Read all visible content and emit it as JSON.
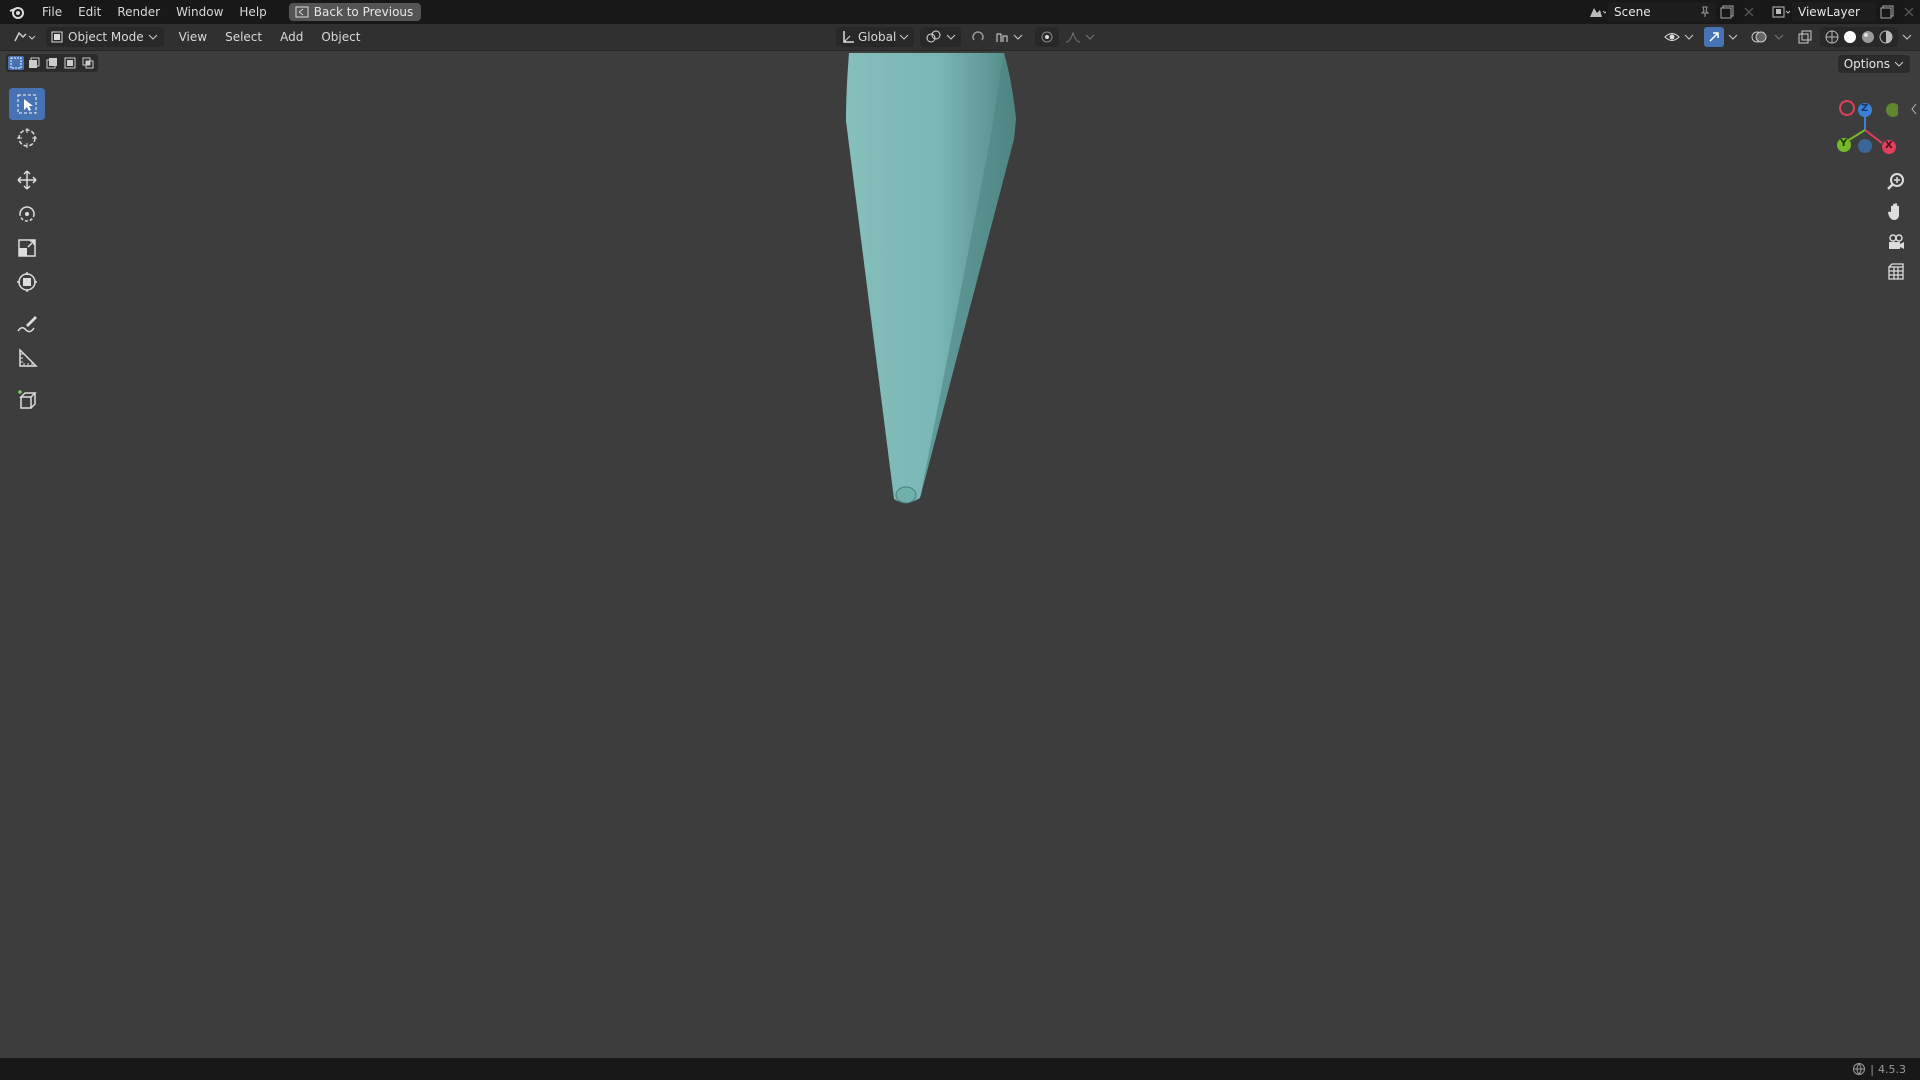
{
  "topbar": {
    "menus": [
      "File",
      "Edit",
      "Render",
      "Window",
      "Help"
    ],
    "back_button": "Back to Previous",
    "scene_name": "Scene",
    "view_layer": "ViewLayer"
  },
  "header": {
    "mode": "Object Mode",
    "menus": [
      "View",
      "Select",
      "Add",
      "Object"
    ],
    "transform_orientation": "Global",
    "options_label": "Options"
  },
  "toolbar": {
    "tools": [
      "select-box",
      "cursor",
      "move",
      "rotate",
      "scale",
      "transform",
      "annotate",
      "measure",
      "add-cube"
    ],
    "active_tool": "select-box"
  },
  "gizmo": {
    "axes": [
      "X",
      "Y",
      "Z"
    ],
    "colors": {
      "x": "#e0405a",
      "y": "#76b82a",
      "z": "#3b82d6"
    }
  },
  "viewport": {
    "background": "#3d3d3d",
    "object": "cone",
    "object_color": "#79b6b4"
  },
  "status": {
    "version": "4.5.3"
  }
}
